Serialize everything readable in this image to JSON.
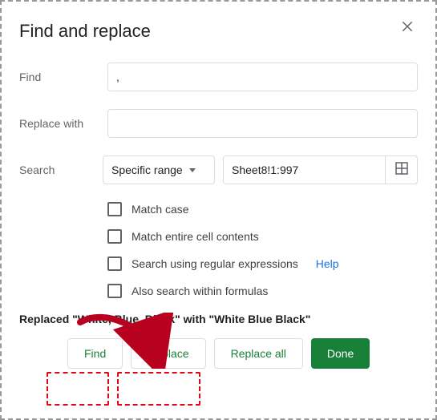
{
  "dialog": {
    "title": "Find and replace"
  },
  "fields": {
    "find_label": "Find",
    "find_value": ",",
    "replace_label": "Replace with",
    "replace_value": "",
    "search_label": "Search",
    "scope_selected": "Specific range",
    "range_value": "Sheet8!1:997"
  },
  "options": {
    "match_case": "Match case",
    "match_entire_cell": "Match entire cell contents",
    "regex": "Search using regular expressions",
    "regex_help": "Help",
    "within_formulas": "Also search within formulas"
  },
  "status": {
    "message": "Replaced \"White, Blue, Black\" with \"White Blue Black\""
  },
  "buttons": {
    "find": "Find",
    "replace": "Replace",
    "replace_all": "Replace all",
    "done": "Done"
  }
}
